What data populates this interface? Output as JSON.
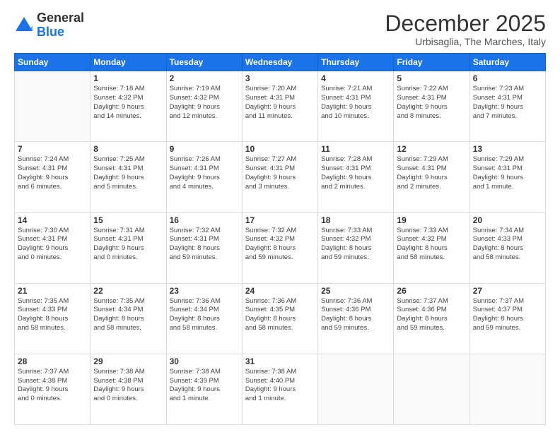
{
  "logo": {
    "general": "General",
    "blue": "Blue"
  },
  "header": {
    "month": "December 2025",
    "location": "Urbisaglia, The Marches, Italy"
  },
  "weekdays": [
    "Sunday",
    "Monday",
    "Tuesday",
    "Wednesday",
    "Thursday",
    "Friday",
    "Saturday"
  ],
  "weeks": [
    [
      {
        "day": "",
        "info": ""
      },
      {
        "day": "1",
        "info": "Sunrise: 7:18 AM\nSunset: 4:32 PM\nDaylight: 9 hours\nand 14 minutes."
      },
      {
        "day": "2",
        "info": "Sunrise: 7:19 AM\nSunset: 4:32 PM\nDaylight: 9 hours\nand 12 minutes."
      },
      {
        "day": "3",
        "info": "Sunrise: 7:20 AM\nSunset: 4:31 PM\nDaylight: 9 hours\nand 11 minutes."
      },
      {
        "day": "4",
        "info": "Sunrise: 7:21 AM\nSunset: 4:31 PM\nDaylight: 9 hours\nand 10 minutes."
      },
      {
        "day": "5",
        "info": "Sunrise: 7:22 AM\nSunset: 4:31 PM\nDaylight: 9 hours\nand 8 minutes."
      },
      {
        "day": "6",
        "info": "Sunrise: 7:23 AM\nSunset: 4:31 PM\nDaylight: 9 hours\nand 7 minutes."
      }
    ],
    [
      {
        "day": "7",
        "info": "Sunrise: 7:24 AM\nSunset: 4:31 PM\nDaylight: 9 hours\nand 6 minutes."
      },
      {
        "day": "8",
        "info": "Sunrise: 7:25 AM\nSunset: 4:31 PM\nDaylight: 9 hours\nand 5 minutes."
      },
      {
        "day": "9",
        "info": "Sunrise: 7:26 AM\nSunset: 4:31 PM\nDaylight: 9 hours\nand 4 minutes."
      },
      {
        "day": "10",
        "info": "Sunrise: 7:27 AM\nSunset: 4:31 PM\nDaylight: 9 hours\nand 3 minutes."
      },
      {
        "day": "11",
        "info": "Sunrise: 7:28 AM\nSunset: 4:31 PM\nDaylight: 9 hours\nand 2 minutes."
      },
      {
        "day": "12",
        "info": "Sunrise: 7:29 AM\nSunset: 4:31 PM\nDaylight: 9 hours\nand 2 minutes."
      },
      {
        "day": "13",
        "info": "Sunrise: 7:29 AM\nSunset: 4:31 PM\nDaylight: 9 hours\nand 1 minute."
      }
    ],
    [
      {
        "day": "14",
        "info": "Sunrise: 7:30 AM\nSunset: 4:31 PM\nDaylight: 9 hours\nand 0 minutes."
      },
      {
        "day": "15",
        "info": "Sunrise: 7:31 AM\nSunset: 4:31 PM\nDaylight: 9 hours\nand 0 minutes."
      },
      {
        "day": "16",
        "info": "Sunrise: 7:32 AM\nSunset: 4:31 PM\nDaylight: 8 hours\nand 59 minutes."
      },
      {
        "day": "17",
        "info": "Sunrise: 7:32 AM\nSunset: 4:32 PM\nDaylight: 8 hours\nand 59 minutes."
      },
      {
        "day": "18",
        "info": "Sunrise: 7:33 AM\nSunset: 4:32 PM\nDaylight: 8 hours\nand 59 minutes."
      },
      {
        "day": "19",
        "info": "Sunrise: 7:33 AM\nSunset: 4:32 PM\nDaylight: 8 hours\nand 58 minutes."
      },
      {
        "day": "20",
        "info": "Sunrise: 7:34 AM\nSunset: 4:33 PM\nDaylight: 8 hours\nand 58 minutes."
      }
    ],
    [
      {
        "day": "21",
        "info": "Sunrise: 7:35 AM\nSunset: 4:33 PM\nDaylight: 8 hours\nand 58 minutes."
      },
      {
        "day": "22",
        "info": "Sunrise: 7:35 AM\nSunset: 4:34 PM\nDaylight: 8 hours\nand 58 minutes."
      },
      {
        "day": "23",
        "info": "Sunrise: 7:36 AM\nSunset: 4:34 PM\nDaylight: 8 hours\nand 58 minutes."
      },
      {
        "day": "24",
        "info": "Sunrise: 7:36 AM\nSunset: 4:35 PM\nDaylight: 8 hours\nand 58 minutes."
      },
      {
        "day": "25",
        "info": "Sunrise: 7:36 AM\nSunset: 4:36 PM\nDaylight: 8 hours\nand 59 minutes."
      },
      {
        "day": "26",
        "info": "Sunrise: 7:37 AM\nSunset: 4:36 PM\nDaylight: 8 hours\nand 59 minutes."
      },
      {
        "day": "27",
        "info": "Sunrise: 7:37 AM\nSunset: 4:37 PM\nDaylight: 8 hours\nand 59 minutes."
      }
    ],
    [
      {
        "day": "28",
        "info": "Sunrise: 7:37 AM\nSunset: 4:38 PM\nDaylight: 9 hours\nand 0 minutes."
      },
      {
        "day": "29",
        "info": "Sunrise: 7:38 AM\nSunset: 4:38 PM\nDaylight: 9 hours\nand 0 minutes."
      },
      {
        "day": "30",
        "info": "Sunrise: 7:38 AM\nSunset: 4:39 PM\nDaylight: 9 hours\nand 1 minute."
      },
      {
        "day": "31",
        "info": "Sunrise: 7:38 AM\nSunset: 4:40 PM\nDaylight: 9 hours\nand 1 minute."
      },
      {
        "day": "",
        "info": ""
      },
      {
        "day": "",
        "info": ""
      },
      {
        "day": "",
        "info": ""
      }
    ]
  ]
}
